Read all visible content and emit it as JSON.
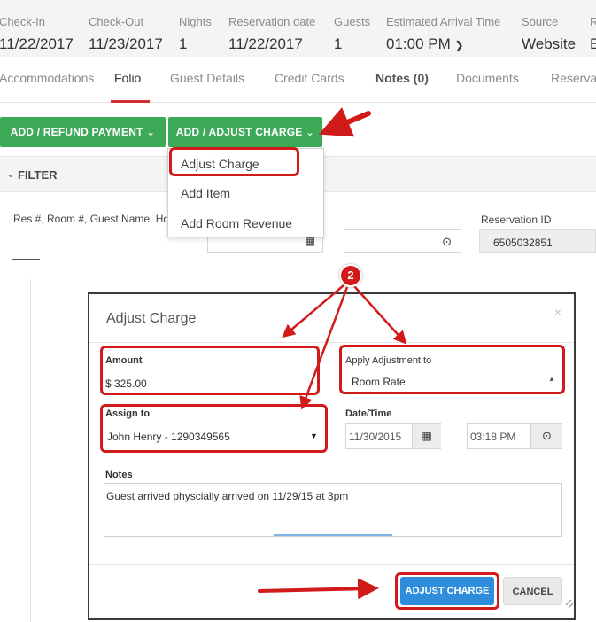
{
  "header": {
    "fields": [
      {
        "label": "Check-In",
        "value": "11/22/2017"
      },
      {
        "label": "Check-Out",
        "value": "11/23/2017"
      },
      {
        "label": "Nights",
        "value": "1"
      },
      {
        "label": "Reservation date",
        "value": "11/22/2017"
      },
      {
        "label": "Guests",
        "value": "1"
      },
      {
        "label": "Estimated Arrival Time",
        "value": "01:00 PM"
      },
      {
        "label": "Source",
        "value": "Website"
      },
      {
        "label": "R",
        "value": "E"
      }
    ]
  },
  "tabs": [
    "Accommodations",
    "Folio",
    "Guest Details",
    "Credit Cards",
    "Notes (0)",
    "Documents",
    "Reserva"
  ],
  "active_tab": "Folio",
  "actions": {
    "add_refund_label": "ADD / REFUND PAYMENT",
    "add_adjust_label": "ADD / ADJUST CHARGE"
  },
  "dropdown": {
    "items": [
      "Adjust Charge",
      "Add Item",
      "Add Room Revenue"
    ]
  },
  "filter": {
    "label": "FILTER",
    "search_label": "Res #, Room #, Guest Name, Ho",
    "reservation_id_label": "Reservation ID",
    "reservation_id_value": "6505032851"
  },
  "modal": {
    "title": "Adjust Charge",
    "close": "×",
    "amount_label": "Amount",
    "amount_value": "$ 325.00",
    "apply_label": "Apply Adjustment to",
    "apply_value": "Room Rate",
    "assign_label": "Assign to",
    "assign_value": "John Henry - 1290349565",
    "datetime_label": "Date/Time",
    "date_value": "11/30/2015",
    "time_value": "03:18 PM",
    "notes_label": "Notes",
    "notes_value": "Guest arrived physcially arrived on 11/29/15 at 3pm",
    "adjust_button": "ADJUST CHARGE",
    "cancel_button": "CANCEL"
  },
  "annotation": {
    "step_number": "2"
  },
  "colors": {
    "green": "#3daa58",
    "blue": "#2f8ddb",
    "annotation_red": "#d11a1a",
    "tab_accent": "#d03030"
  }
}
